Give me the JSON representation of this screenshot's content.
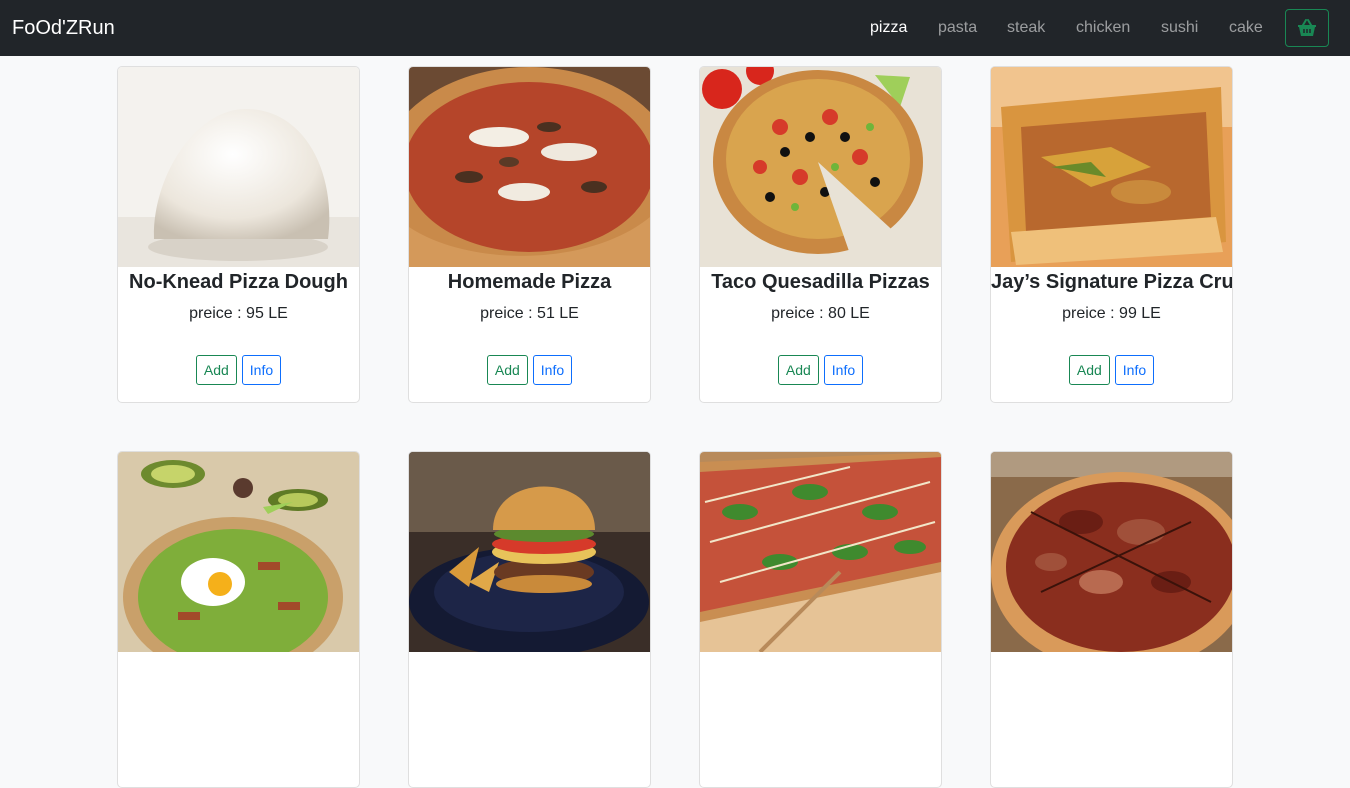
{
  "navbar": {
    "brand": "FoOd'ZRun",
    "links": [
      {
        "label": "pizza",
        "active": true
      },
      {
        "label": "pasta",
        "active": false
      },
      {
        "label": "steak",
        "active": false
      },
      {
        "label": "chicken",
        "active": false
      },
      {
        "label": "sushi",
        "active": false
      },
      {
        "label": "cake",
        "active": false
      }
    ],
    "cart_icon": "basket-icon"
  },
  "cards": [
    {
      "title": "No-Knead Pizza Dough",
      "price": "preice : 95 LE",
      "add": "Add",
      "info": "Info",
      "image": "pizza-dough"
    },
    {
      "title": "Homemade Pizza",
      "price": "preice : 51 LE",
      "add": "Add",
      "info": "Info",
      "image": "homemade-pizza"
    },
    {
      "title": "Taco Quesadilla Pizzas",
      "price": "preice : 80 LE",
      "add": "Add",
      "info": "Info",
      "image": "taco-pizza"
    },
    {
      "title": "Jay’s Signature Pizza Crust",
      "price": "preice : 99 LE",
      "add": "Add",
      "info": "Info",
      "image": "pizza-crust"
    },
    {
      "image": "avocado-egg-pizza"
    },
    {
      "image": "burger"
    },
    {
      "image": "greens-pizza"
    },
    {
      "image": "steak-pizza"
    }
  ],
  "colors": {
    "navbar_bg": "#212529",
    "page_bg": "#f8f9fa",
    "success": "#198754",
    "primary": "#0d6efd"
  }
}
